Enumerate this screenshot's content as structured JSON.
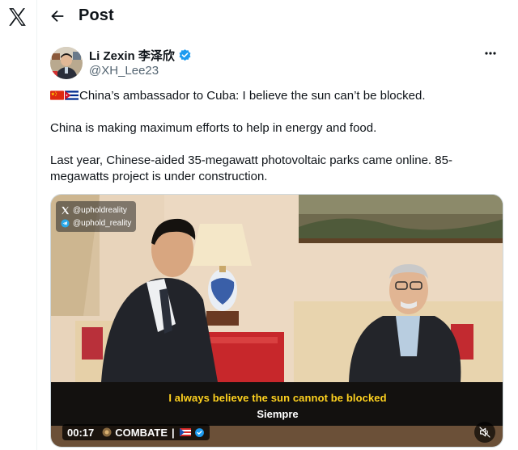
{
  "header": {
    "title": "Post"
  },
  "author": {
    "name": "Li Zexin 李泽欣",
    "handle": "@XH_Lee23"
  },
  "tweet": {
    "line1": "China’s ambassador to Cuba: I believe the sun can’t be blocked.",
    "line2": "China is making maximum efforts to help in energy and food.",
    "line3": "Last year, Chinese-aided 35-megawatt photovoltaic parks came online. 85-megawatts project is under construction."
  },
  "media": {
    "watermark_x": "@upholdreality",
    "watermark_telegram": "@uphold_reality",
    "caption_yellow": "I always believe the sun cannot be blocked",
    "caption_white": "Siempre",
    "timestamp": "00:17",
    "channel": "COMBATE"
  },
  "icons": {
    "logo": "x-logo-icon",
    "back": "back-arrow-icon",
    "verified": "verified-badge-icon",
    "more": "more-icon",
    "mute": "mute-icon"
  },
  "colors": {
    "verified": "#1d9bf0",
    "caption_yellow": "#ffd21f",
    "secondary_text": "#536471"
  }
}
